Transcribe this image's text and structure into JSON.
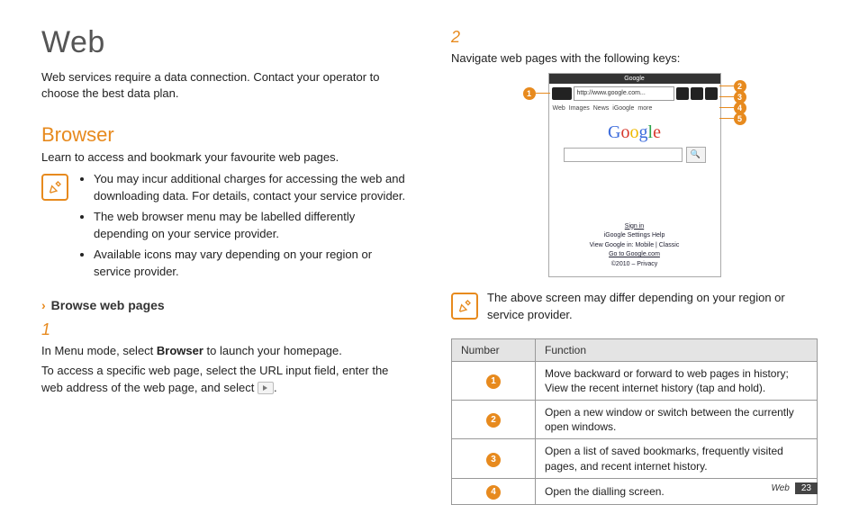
{
  "title": "Web",
  "intro": "Web services require a data connection. Contact your operator to choose the best data plan.",
  "section": {
    "heading": "Browser",
    "lead": "Learn to access and bookmark your favourite web pages.",
    "notes": [
      "You may incur additional charges for accessing the web and downloading data. For details, contact your service provider.",
      "The web browser menu may be labelled differently depending on your service provider.",
      "Available icons may vary depending on your region or service provider."
    ],
    "sub_heading": "Browse web pages",
    "step1_num": "1",
    "step1_a_pre": "In Menu mode, select ",
    "step1_a_bold": "Browser",
    "step1_a_post": " to launch your homepage.",
    "step1_b": "To access a specific web page, select the URL input field, enter the web address of the web page, and select ",
    "step1_b_post": "."
  },
  "right": {
    "step2_num": "2",
    "step2_text": "Navigate web pages with the following keys:",
    "screenshot": {
      "top_title": "Google",
      "url_text": "http://www.google.com...",
      "tabs": [
        "Web",
        "Images",
        "News",
        "iGoogle",
        "more"
      ],
      "logo_text": "Google",
      "links_line1": "Sign in",
      "links_line2": "iGoogle   Settings   Help",
      "links_line3": "View Google in: Mobile | Classic",
      "links_line4": "Go to Google.com",
      "links_line5": "©2010 – Privacy"
    },
    "note2": "The above screen may differ depending on your region or service provider.",
    "table": {
      "h1": "Number",
      "h2": "Function",
      "rows": [
        {
          "n": "1",
          "f": "Move backward or forward to web pages in history; View the recent internet history (tap and hold)."
        },
        {
          "n": "2",
          "f": "Open a new window or switch between the currently open windows."
        },
        {
          "n": "3",
          "f": "Open a list of saved bookmarks, frequently visited pages, and recent internet history."
        },
        {
          "n": "4",
          "f": "Open the dialling screen."
        }
      ]
    }
  },
  "footer": {
    "section": "Web",
    "page": "23"
  }
}
